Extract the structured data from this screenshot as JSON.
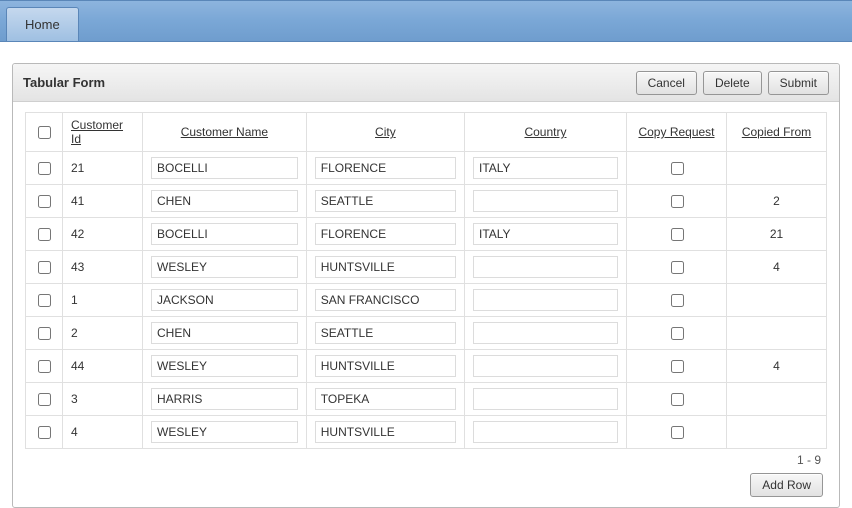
{
  "topbar": {
    "home": "Home"
  },
  "region": {
    "title": "Tabular Form",
    "buttons": {
      "cancel": "Cancel",
      "delete": "Delete",
      "submit": "Submit",
      "add_row": "Add Row"
    }
  },
  "table": {
    "headers": {
      "customer_id": "Customer Id",
      "customer_name": "Customer Name",
      "city": "City",
      "country": "Country",
      "copy_request": "Copy Request",
      "copied_from": "Copied From"
    },
    "pagination": "1 - 9",
    "rows": [
      {
        "customer_id": "21",
        "customer_name": "BOCELLI",
        "city": "FLORENCE",
        "country": "ITALY",
        "copied_from": ""
      },
      {
        "customer_id": "41",
        "customer_name": "CHEN",
        "city": "SEATTLE",
        "country": "",
        "copied_from": "2"
      },
      {
        "customer_id": "42",
        "customer_name": "BOCELLI",
        "city": "FLORENCE",
        "country": "ITALY",
        "copied_from": "21"
      },
      {
        "customer_id": "43",
        "customer_name": "WESLEY",
        "city": "HUNTSVILLE",
        "country": "",
        "copied_from": "4"
      },
      {
        "customer_id": "1",
        "customer_name": "JACKSON",
        "city": "SAN FRANCISCO",
        "country": "",
        "copied_from": ""
      },
      {
        "customer_id": "2",
        "customer_name": "CHEN",
        "city": "SEATTLE",
        "country": "",
        "copied_from": ""
      },
      {
        "customer_id": "44",
        "customer_name": "WESLEY",
        "city": "HUNTSVILLE",
        "country": "",
        "copied_from": "4"
      },
      {
        "customer_id": "3",
        "customer_name": "HARRIS",
        "city": "TOPEKA",
        "country": "",
        "copied_from": ""
      },
      {
        "customer_id": "4",
        "customer_name": "WESLEY",
        "city": "HUNTSVILLE",
        "country": "",
        "copied_from": ""
      }
    ]
  }
}
